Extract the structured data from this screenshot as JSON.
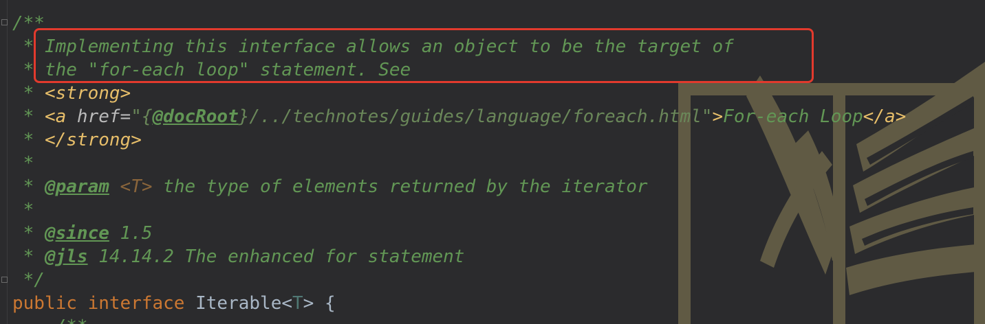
{
  "code": {
    "l1": "/**",
    "l2": " * Implementing this interface allows an object to be the target of",
    "l3": " * the \"for-each loop\" statement. See",
    "l4": {
      "star": " * ",
      "tag": "<strong>"
    },
    "l5": {
      "star": " * ",
      "a_open": "<a",
      "href": " href=",
      "q1": "\"",
      "brace_open": "{",
      "docroot": "@docRoot",
      "brace_close": "}",
      "path": "/../technotes/guides/language/foreach.html",
      "q2": "\"",
      "gt": ">",
      "text": "For-each Loop",
      "a_close": "</a>"
    },
    "l6": {
      "star": " * ",
      "tag": "</strong>"
    },
    "l7": " *",
    "l8": {
      "star": " * ",
      "tag": "@param",
      "sp": " ",
      "param": "<T>",
      "text": " the type of elements returned by the iterator"
    },
    "l9": " *",
    "l10": {
      "star": " * ",
      "tag": "@since",
      "text": " 1.5"
    },
    "l11": {
      "star": " * ",
      "tag": "@jls",
      "text": " 14.14.2 The enhanced for statement"
    },
    "l12": " */",
    "l13": {
      "kw1": "public",
      "sp1": " ",
      "kw2": "interface",
      "sp2": " ",
      "name": "Iterable",
      "lt": "<",
      "tp": "T",
      "gt": ">",
      "brace": " {"
    },
    "l14": "    /**"
  },
  "colors": {
    "background": "#2b2b2d",
    "comment": "#629755",
    "keyword": "#cc7832",
    "identifier": "#a9b7c6",
    "highlight_border": "#e23a2d",
    "watermark": "#8c8258"
  },
  "watermark_icon": "wings-of-freedom-emblem-icon"
}
